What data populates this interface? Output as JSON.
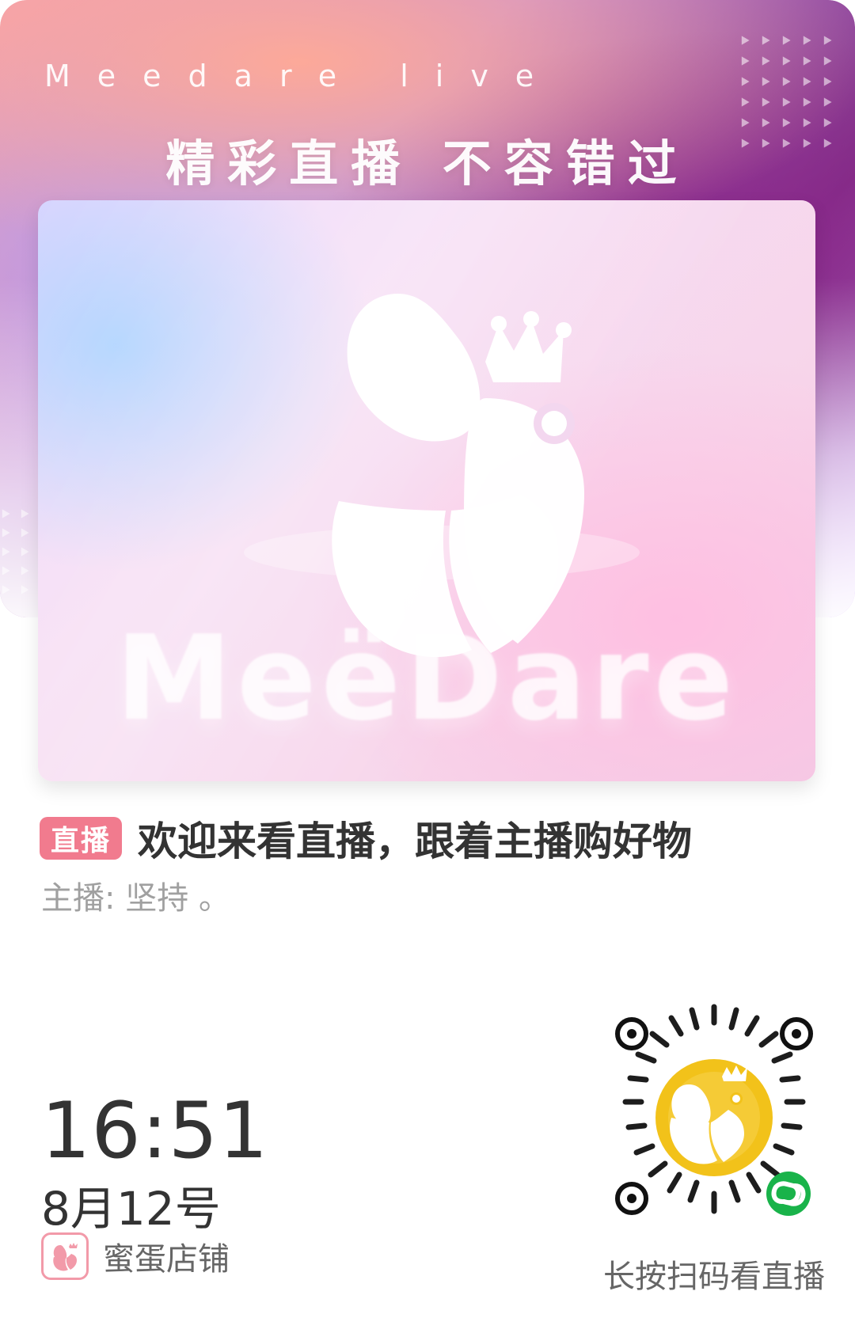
{
  "banner": {
    "top_text": "Meedare live",
    "slogan": "精彩直播 不容错过",
    "gradient_colors": [
      "#f2a0b1",
      "#c58fd7",
      "#7e2d84",
      "#d9b3ff"
    ]
  },
  "cover": {
    "wordmark": "MeëDare",
    "logo_icon": "bee-with-crown-logo"
  },
  "live": {
    "badge": "直播",
    "title": "欢迎来看直播，跟着主播购好物",
    "host_line": "主播: 坚持 。"
  },
  "meta": {
    "time": "16:51",
    "date": "8月12号"
  },
  "store": {
    "name": "蜜蛋店铺",
    "icon": "bee-with-crown-icon"
  },
  "qr": {
    "caption": "长按扫码看直播",
    "badge_icon": "mini-program-link-icon"
  },
  "colors": {
    "accent_pink": "#f17b8e",
    "text_dark": "#333333",
    "text_muted": "#a0a0a0",
    "qr_yellow": "#f2c21a",
    "qr_green": "#19b34a"
  }
}
